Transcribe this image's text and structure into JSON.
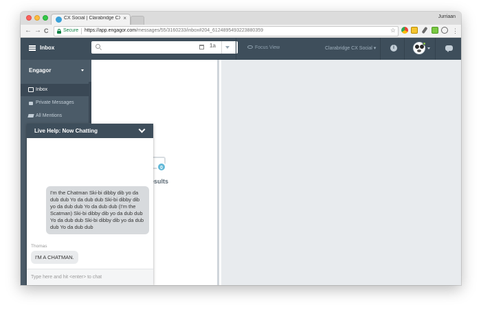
{
  "browser": {
    "tab_title": "CX Social | Clarabridge CX So",
    "tab_close": "×",
    "profile_name": "Jurriaan",
    "secure_label": "Secure",
    "url_host": "https://app.engagor.com",
    "url_path": "/messages/55/3160233/inbox#204_6124895493223880359",
    "back": "←",
    "forward": "→",
    "reload": "C",
    "bookmark_star": "☆",
    "menu": "⋮"
  },
  "header": {
    "title": "Inbox",
    "sort_label": "1a",
    "focus_view": "Focus View",
    "account": "Clarabridge CX Social ▾",
    "info": "i"
  },
  "sidebar": {
    "team": "Engagor",
    "items": [
      {
        "label": "Inbox",
        "icon": "inbox-icon"
      },
      {
        "label": "Private Messages",
        "icon": "lock-icon"
      },
      {
        "label": "All Mentions",
        "icon": "mentions-icon"
      }
    ]
  },
  "list": {
    "empty_count": "0",
    "empty_text": "esults"
  },
  "chat": {
    "title": "Live Help: Now Chatting",
    "incoming_message": "I'm the Chatman Ski-bi dibby dib yo da dub dub Yo da dub dub Ski-bi dibby dib yo da dub dub Yo da dub dub (I'm the Scatman) Ski-bi dibby dib yo da dub dub Yo da dub dub Ski-bi dibby dib yo da dub dub Yo da dub dub",
    "sender": "Thomas",
    "outgoing_message": "I'M A CHATMAN.",
    "input_placeholder": "Type here and hit <enter> to chat"
  },
  "colors": {
    "header_bg": "#3e4e5b",
    "sidebar_bg": "#4b5b68",
    "accent": "#63b9d8",
    "detail_bg": "#e8ebee"
  }
}
